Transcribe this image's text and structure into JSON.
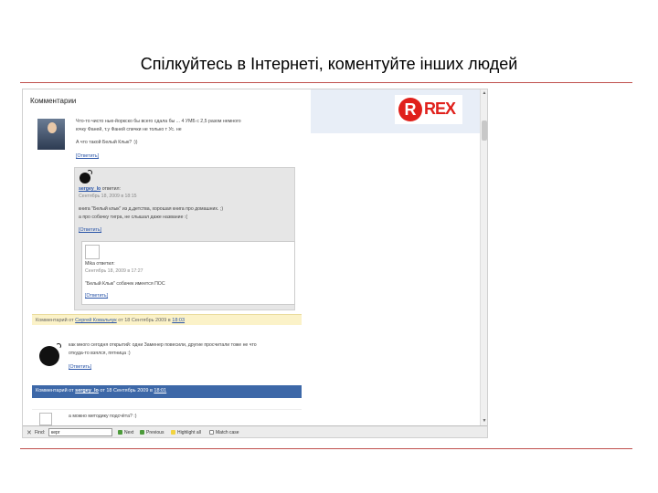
{
  "slide": {
    "title": "Спілкуйтесь в Інтернеті, коментуйте інших людей"
  },
  "page": {
    "comments_heading": "Комментарии",
    "ad_brand": "REX"
  },
  "comment1": {
    "lines": [
      "Что-то чисто нью-йоркско бы всего сдала бы ... 4 УМБ с 2,5 разом немного",
      "ючку Фаней, т.у Фаней спички не только т Ус. не",
      "А что такой Белый Клык? :))"
    ],
    "reply_link": "[Ответить]",
    "footer_prefix": "Комментарий от",
    "author": "Сергей Ковальчук",
    "footer_date": "от 18 Сентябрь 2009 в",
    "time": "18:03"
  },
  "reply1": {
    "author": "sergey_lo",
    "verb": "ответил:",
    "date": "Сентябрь 18, 2009 в 18:15",
    "lines": [
      "книга \"Белый клык\" из д.детства, хорошая книга про домашних. ;)",
      "а про собачку тигра, не слышал даже название :("
    ],
    "reply_link": "[Ответить]"
  },
  "reply2": {
    "author": "Mika",
    "verb": "ответил:",
    "date": "Сентябрь 18, 2009 в 17:27",
    "text": "\"Белый Клык\" собачек имеется ПОС",
    "reply_link": "[Ответить]"
  },
  "comment2": {
    "lines": [
      "как много сегодня открытий: одни Заменер повесили, другие просчитали тоже не что",
      "откуда-то взялся, пятница :)"
    ],
    "reply_link": "[Ответить]",
    "footer_prefix": "Комментарий от",
    "author": "sergey_lo",
    "footer_date": "от 18 Сентябрь 2009 в",
    "time": "18:01"
  },
  "comment3": {
    "text": "а можно методику подсчёта? :)"
  },
  "findbar": {
    "label": "Find:",
    "value": "керг",
    "next": "Next",
    "previous": "Previous",
    "highlight": "Highlight all",
    "match_case": "Match case"
  }
}
